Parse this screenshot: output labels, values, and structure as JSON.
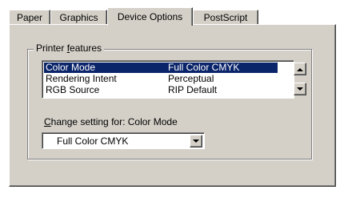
{
  "tabs": [
    {
      "label": "Paper",
      "active": false
    },
    {
      "label": "Graphics",
      "active": false
    },
    {
      "label": "Device Options",
      "active": true
    },
    {
      "label": "PostScript",
      "active": false
    }
  ],
  "printer_features": {
    "title_prefix": "Printer ",
    "title_accel": "f",
    "title_suffix": "eatures",
    "rows": [
      {
        "feature": "Color Mode",
        "setting": "Full Color CMYK",
        "selected": true
      },
      {
        "feature": "Rendering Intent",
        "setting": "Perceptual",
        "selected": false
      },
      {
        "feature": "RGB Source",
        "setting": "RIP Default",
        "selected": false
      }
    ]
  },
  "change_setting": {
    "label_accel": "C",
    "label_rest": "hange setting for:  Color Mode",
    "selected_value": "Full Color CMYK"
  },
  "colors": {
    "face": "#d4d0c8",
    "selection": "#0a246a"
  }
}
